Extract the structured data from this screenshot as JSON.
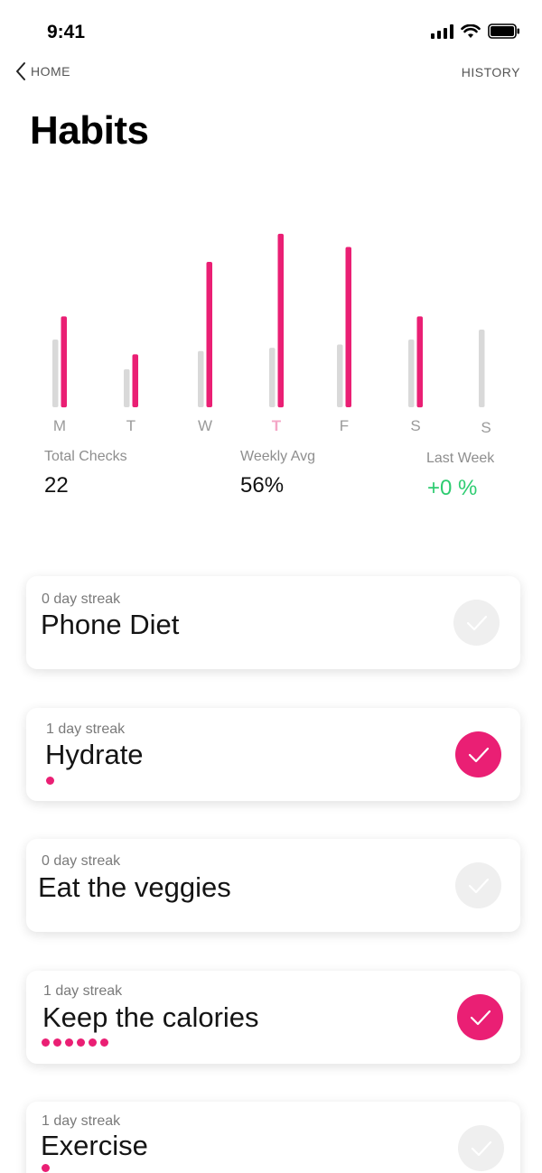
{
  "status": {
    "time": "9:41"
  },
  "nav": {
    "back_label": "HOME",
    "history_label": "HISTORY"
  },
  "page": {
    "title": "Habits"
  },
  "colors": {
    "accent": "#ea1f74",
    "prev_bar": "#d9d9d9",
    "positive": "#2ecc71"
  },
  "chart_data": {
    "type": "bar",
    "categories": [
      "M",
      "T",
      "W",
      "T",
      "F",
      "S",
      "S"
    ],
    "highlighted_category_index": 3,
    "series": [
      {
        "values": [
          4.1,
          2.3,
          3.4,
          3.6,
          3.8,
          4.1,
          4.7
        ]
      },
      {
        "values": [
          5.5,
          3.2,
          8.8,
          10.5,
          9.7,
          5.5,
          0
        ]
      }
    ],
    "ylim": [
      0,
      11
    ]
  },
  "stats": {
    "total_checks": {
      "label": "Total Checks",
      "value": "22"
    },
    "weekly_avg": {
      "label": "Weekly Avg",
      "value": "56%"
    },
    "last_week": {
      "label": "Last Week",
      "value": "+0 %"
    }
  },
  "habits": [
    {
      "streak": "0 day streak",
      "name": "Phone Diet",
      "checked": false,
      "dots": 0
    },
    {
      "streak": "1 day streak",
      "name": "Hydrate",
      "checked": true,
      "dots": 1
    },
    {
      "streak": "0 day streak",
      "name": "Eat the veggies",
      "checked": false,
      "dots": 0
    },
    {
      "streak": "1 day streak",
      "name": "Keep the calories",
      "checked": true,
      "dots": 6
    },
    {
      "streak": "1 day streak",
      "name": "Exercise",
      "checked": false,
      "dots": 1
    }
  ],
  "icons": {
    "back": "chevron-left-icon",
    "check": "check-icon",
    "signal": "signal-icon",
    "wifi": "wifi-icon",
    "battery": "battery-icon"
  }
}
